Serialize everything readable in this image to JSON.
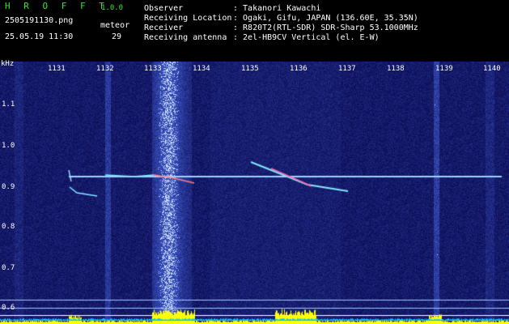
{
  "app": {
    "name": "H R O F F T",
    "version": "1.0.0"
  },
  "file": {
    "name": "2505191130.png",
    "datetime": "25.05.19 11:30"
  },
  "detector": {
    "label": "meteor",
    "count": "29"
  },
  "info": {
    "observer_label": "Observer",
    "observer_value": ": Takanori Kawachi",
    "location_label": "Receiving Location",
    "location_value": ": Ogaki, Gifu, JAPAN (136.60E, 35.35N)",
    "receiver_label": "Receiver",
    "receiver_value": ": R820T2(RTL-SDR) SDR-Sharp 53.1000MHz",
    "antenna_label": "Receiving antenna",
    "antenna_value": ": 2el-HB9CV Vertical (el. E-W)"
  },
  "axes": {
    "x_unit": "kHz",
    "x_ticks": [
      "1131",
      "1132",
      "1133",
      "1134",
      "1135",
      "1136",
      "1137",
      "1138",
      "1139",
      "1140"
    ],
    "y_ticks": [
      "1.1",
      "1.0",
      "0.9",
      "0.8",
      "0.7",
      "0.6"
    ]
  },
  "colors": {
    "background": "#000000",
    "waterfall": "#0a0a64",
    "text": "#ffffff",
    "accent": "#ffff00",
    "title": "#39e039",
    "baseline": "#ffff00",
    "sky": "#00c8ff"
  }
}
